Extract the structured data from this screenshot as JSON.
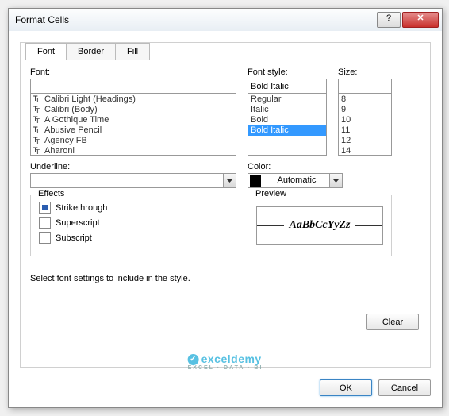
{
  "title": "Format Cells",
  "tabs": {
    "font": "Font",
    "border": "Border",
    "fill": "Fill"
  },
  "labels": {
    "font": "Font:",
    "font_style": "Font style:",
    "size": "Size:",
    "underline": "Underline:",
    "color": "Color:",
    "effects": "Effects",
    "preview": "Preview"
  },
  "font_input": "",
  "font_list": [
    "Calibri Light (Headings)",
    "Calibri (Body)",
    "A Gothique Time",
    "Abusive Pencil",
    "Agency FB",
    "Aharoni"
  ],
  "style_input": "Bold Italic",
  "style_list": [
    "Regular",
    "Italic",
    "Bold",
    "Bold Italic"
  ],
  "style_selected": "Bold Italic",
  "size_input": "",
  "size_list": [
    "8",
    "9",
    "10",
    "11",
    "12",
    "14"
  ],
  "underline_value": "",
  "color_value": "Automatic",
  "effects": {
    "strike": "Strikethrough",
    "super": "Superscript",
    "sub": "Subscript"
  },
  "preview_text": "AaBbCcYyZz",
  "help_text": "Select font settings to include in the style.",
  "buttons": {
    "clear": "Clear",
    "ok": "OK",
    "cancel": "Cancel"
  },
  "watermark": {
    "brand": "exceldemy",
    "tag": "EXCEL · DATA · BI"
  }
}
